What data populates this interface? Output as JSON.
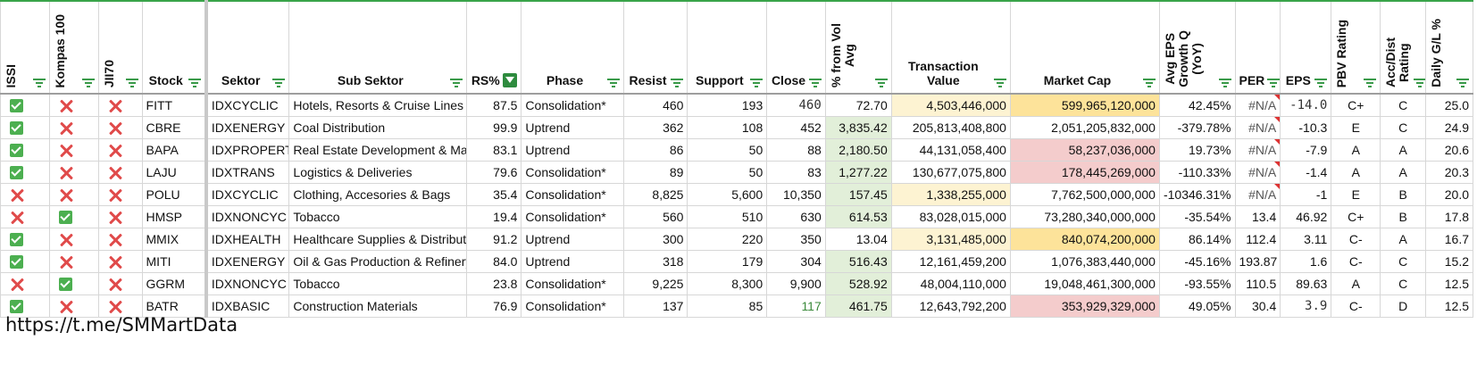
{
  "columns": {
    "issi": "ISSI",
    "kompas100": "Kompas 100",
    "jii70": "JII70",
    "stock": "Stock",
    "sektor": "Sektor",
    "sub_sektor": "Sub Sektor",
    "rs": "RS%",
    "phase": "Phase",
    "resist": "Resist",
    "support": "Support",
    "close": "Close",
    "pct_vol_line1": "% from Vol",
    "pct_vol_line2": "Avg",
    "transaction_value_line1": "Transaction",
    "transaction_value_line2": "Value",
    "market_cap": "Market Cap",
    "eps_growth_line1": "Avg EPS",
    "eps_growth_line2": "Growth Q",
    "eps_growth_line3": "(YoY)",
    "per": "PER",
    "eps": "EPS",
    "pbv_rating": "PBV Rating",
    "accdist_line1": "Acc/Dist",
    "accdist_line2": "Rating",
    "daily_gl": "Daily G/L %"
  },
  "rows": [
    {
      "issi": "check",
      "kompas": "cross",
      "jii": "cross",
      "stock": "FITT",
      "sektor": "IDXCYCLIC",
      "sub": "Hotels, Resorts & Cruise Lines",
      "rs": "87.5",
      "phase": "Consolidation*",
      "resist": "460",
      "support": "193",
      "close": "460",
      "volavg": "72.70",
      "trx": "4,503,446,000",
      "mcap": "599,965,120,000",
      "epsg": "42.45%",
      "per": "#N/A",
      "eps": "-14.0",
      "pbv": "C+",
      "ad": "C",
      "gl": "25.0"
    },
    {
      "issi": "check",
      "kompas": "cross",
      "jii": "cross",
      "stock": "CBRE",
      "sektor": "IDXENERGY",
      "sub": "Coal Distribution",
      "rs": "99.9",
      "phase": "Uptrend",
      "resist": "362",
      "support": "108",
      "close": "452",
      "volavg": "3,835.42",
      "trx": "205,813,408,800",
      "mcap": "2,051,205,832,000",
      "epsg": "-379.78%",
      "per": "#N/A",
      "eps": "-10.3",
      "pbv": "E",
      "ad": "C",
      "gl": "24.9"
    },
    {
      "issi": "check",
      "kompas": "cross",
      "jii": "cross",
      "stock": "BAPA",
      "sektor": "IDXPROPERT",
      "sub": "Real Estate Development & Management",
      "rs": "83.1",
      "phase": "Uptrend",
      "resist": "86",
      "support": "50",
      "close": "88",
      "volavg": "2,180.50",
      "trx": "44,131,058,400",
      "mcap": "58,237,036,000",
      "epsg": "19.73%",
      "per": "#N/A",
      "eps": "-7.9",
      "pbv": "A",
      "ad": "A",
      "gl": "20.6"
    },
    {
      "issi": "check",
      "kompas": "cross",
      "jii": "cross",
      "stock": "LAJU",
      "sektor": "IDXTRANS",
      "sub": "Logistics & Deliveries",
      "rs": "79.6",
      "phase": "Consolidation*",
      "resist": "89",
      "support": "50",
      "close": "83",
      "volavg": "1,277.22",
      "trx": "130,677,075,800",
      "mcap": "178,445,269,000",
      "epsg": "-110.33%",
      "per": "#N/A",
      "eps": "-1.4",
      "pbv": "A",
      "ad": "A",
      "gl": "20.3"
    },
    {
      "issi": "cross",
      "kompas": "cross",
      "jii": "cross",
      "stock": "POLU",
      "sektor": "IDXCYCLIC",
      "sub": "Clothing, Accesories & Bags",
      "rs": "35.4",
      "phase": "Consolidation*",
      "resist": "8,825",
      "support": "5,600",
      "close": "10,350",
      "volavg": "157.45",
      "trx": "1,338,255,000",
      "mcap": "7,762,500,000,000",
      "epsg": "-10346.31%",
      "per": "#N/A",
      "eps": "-1",
      "pbv": "E",
      "ad": "B",
      "gl": "20.0"
    },
    {
      "issi": "cross",
      "kompas": "check",
      "jii": "cross",
      "stock": "HMSP",
      "sektor": "IDXNONCYC",
      "sub": "Tobacco",
      "rs": "19.4",
      "phase": "Consolidation*",
      "resist": "560",
      "support": "510",
      "close": "630",
      "volavg": "614.53",
      "trx": "83,028,015,000",
      "mcap": "73,280,340,000,000",
      "epsg": "-35.54%",
      "per": "13.4",
      "eps": "46.92",
      "pbv": "C+",
      "ad": "B",
      "gl": "17.8"
    },
    {
      "issi": "check",
      "kompas": "cross",
      "jii": "cross",
      "stock": "MMIX",
      "sektor": "IDXHEALTH",
      "sub": "Healthcare Supplies & Distribution",
      "rs": "91.2",
      "phase": "Uptrend",
      "resist": "300",
      "support": "220",
      "close": "350",
      "volavg": "13.04",
      "trx": "3,131,485,000",
      "mcap": "840,074,200,000",
      "epsg": "86.14%",
      "per": "112.4",
      "eps": "3.11",
      "pbv": "C-",
      "ad": "A",
      "gl": "16.7"
    },
    {
      "issi": "check",
      "kompas": "cross",
      "jii": "cross",
      "stock": "MITI",
      "sektor": "IDXENERGY",
      "sub": "Oil & Gas Production & Refinery",
      "rs": "84.0",
      "phase": "Uptrend",
      "resist": "318",
      "support": "179",
      "close": "304",
      "volavg": "516.43",
      "trx": "12,161,459,200",
      "mcap": "1,076,383,440,000",
      "epsg": "-45.16%",
      "per": "193.87",
      "eps": "1.6",
      "pbv": "C-",
      "ad": "C",
      "gl": "15.2"
    },
    {
      "issi": "cross",
      "kompas": "check",
      "jii": "cross",
      "stock": "GGRM",
      "sektor": "IDXNONCYC",
      "sub": "Tobacco",
      "rs": "23.8",
      "phase": "Consolidation*",
      "resist": "9,225",
      "support": "8,300",
      "close": "9,900",
      "volavg": "528.92",
      "trx": "48,004,110,000",
      "mcap": "19,048,461,300,000",
      "epsg": "-93.55%",
      "per": "110.5",
      "eps": "89.63",
      "pbv": "A",
      "ad": "C",
      "gl": "12.5"
    },
    {
      "issi": "check",
      "kompas": "cross",
      "jii": "cross",
      "stock": "BATR",
      "sektor": "IDXBASIC",
      "sub": "Construction Materials",
      "rs": "76.9",
      "phase": "Consolidation*",
      "resist": "137",
      "support": "85",
      "close": "117",
      "volavg": "461.75",
      "trx": "12,643,792,200",
      "mcap": "353,929,329,000",
      "epsg": "49.05%",
      "per": "30.4",
      "eps": "3.9",
      "pbv": "C-",
      "ad": "D",
      "gl": "12.5"
    }
  ],
  "colors": {
    "vol_green": "#e2efd9",
    "trx_yellow": "#fdf3d2",
    "mcap_orange": "#fde39a",
    "mcap_pink": "#f4cccc",
    "check_green": "#4caf50",
    "cross_red": "#e04a4a"
  },
  "footer": "https://t.me/SMMartData"
}
